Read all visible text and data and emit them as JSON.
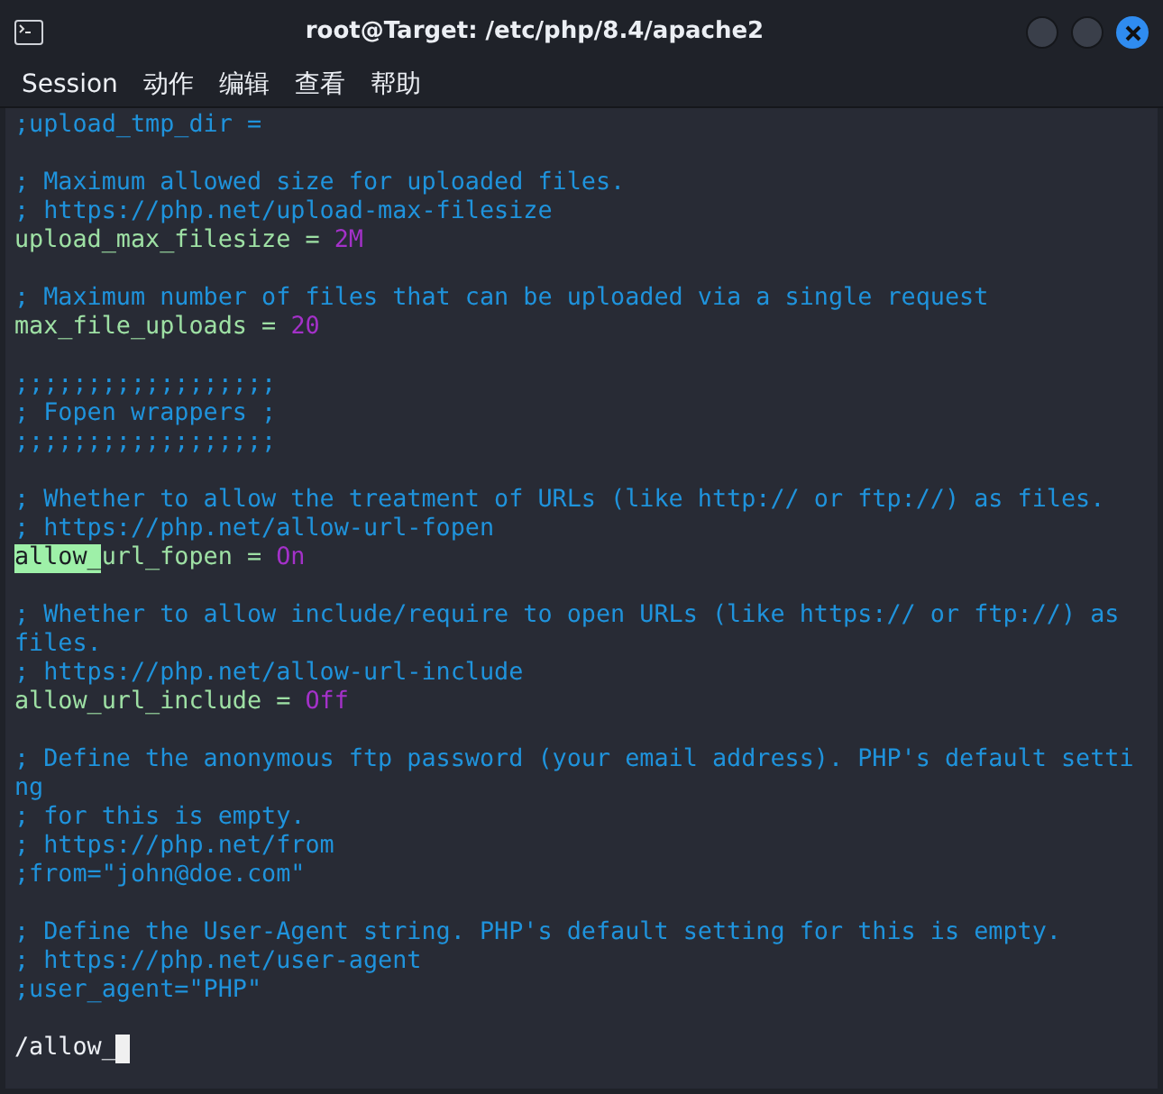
{
  "window": {
    "title": "root@Target: /etc/php/8.4/apache2"
  },
  "menu": [
    "Session",
    "动作",
    "编辑",
    "查看",
    "帮助"
  ],
  "lines": [
    {
      "kind": "text",
      "segments": [
        {
          "kind": "comment",
          "text": ";upload_tmp_dir ="
        }
      ]
    },
    {
      "kind": "blank"
    },
    {
      "kind": "text",
      "segments": [
        {
          "kind": "comment",
          "text": "; Maximum allowed size for uploaded files."
        }
      ]
    },
    {
      "kind": "text",
      "segments": [
        {
          "kind": "comment",
          "text": "; https://php.net/upload-max-filesize"
        }
      ]
    },
    {
      "kind": "text",
      "segments": [
        {
          "kind": "key",
          "text": "upload_max_filesize = "
        },
        {
          "kind": "value",
          "text": "2M"
        }
      ]
    },
    {
      "kind": "blank"
    },
    {
      "kind": "text",
      "segments": [
        {
          "kind": "comment",
          "text": "; Maximum number of files that can be uploaded via a single request"
        }
      ]
    },
    {
      "kind": "text",
      "segments": [
        {
          "kind": "key",
          "text": "max_file_uploads = "
        },
        {
          "kind": "value",
          "text": "20"
        }
      ]
    },
    {
      "kind": "blank"
    },
    {
      "kind": "text",
      "segments": [
        {
          "kind": "comment",
          "text": ";;;;;;;;;;;;;;;;;;"
        }
      ]
    },
    {
      "kind": "text",
      "segments": [
        {
          "kind": "comment",
          "text": "; Fopen wrappers ;"
        }
      ]
    },
    {
      "kind": "text",
      "segments": [
        {
          "kind": "comment",
          "text": ";;;;;;;;;;;;;;;;;;"
        }
      ]
    },
    {
      "kind": "blank"
    },
    {
      "kind": "text",
      "segments": [
        {
          "kind": "comment",
          "text": "; Whether to allow the treatment of URLs (like http:// or ftp://) as files."
        }
      ]
    },
    {
      "kind": "text",
      "segments": [
        {
          "kind": "comment",
          "text": "; https://php.net/allow-url-fopen"
        }
      ]
    },
    {
      "kind": "text",
      "segments": [
        {
          "kind": "match",
          "text": "allow_"
        },
        {
          "kind": "key",
          "text": "url_fopen = "
        },
        {
          "kind": "value",
          "text": "On"
        }
      ]
    },
    {
      "kind": "blank"
    },
    {
      "kind": "text",
      "segments": [
        {
          "kind": "comment",
          "text": "; Whether to allow include/require to open URLs (like https:// or ftp://) as"
        }
      ]
    },
    {
      "kind": "text",
      "segments": [
        {
          "kind": "comment",
          "text": "files."
        }
      ]
    },
    {
      "kind": "text",
      "segments": [
        {
          "kind": "comment",
          "text": "; https://php.net/allow-url-include"
        }
      ]
    },
    {
      "kind": "text",
      "segments": [
        {
          "kind": "key",
          "text": "allow_url_include = "
        },
        {
          "kind": "value",
          "text": "Off"
        }
      ]
    },
    {
      "kind": "blank"
    },
    {
      "kind": "text",
      "segments": [
        {
          "kind": "comment",
          "text": "; Define the anonymous ftp password (your email address). PHP's default setti"
        }
      ]
    },
    {
      "kind": "text",
      "segments": [
        {
          "kind": "comment",
          "text": "ng"
        }
      ]
    },
    {
      "kind": "text",
      "segments": [
        {
          "kind": "comment",
          "text": "; for this is empty."
        }
      ]
    },
    {
      "kind": "text",
      "segments": [
        {
          "kind": "comment",
          "text": "; https://php.net/from"
        }
      ]
    },
    {
      "kind": "text",
      "segments": [
        {
          "kind": "comment",
          "text": ";from=\"john@doe.com\""
        }
      ]
    },
    {
      "kind": "blank"
    },
    {
      "kind": "text",
      "segments": [
        {
          "kind": "comment",
          "text": "; Define the User-Agent string. PHP's default setting for this is empty."
        }
      ]
    },
    {
      "kind": "text",
      "segments": [
        {
          "kind": "comment",
          "text": "; https://php.net/user-agent"
        }
      ]
    },
    {
      "kind": "text",
      "segments": [
        {
          "kind": "comment",
          "text": ";user_agent=\"PHP\""
        }
      ]
    },
    {
      "kind": "blank"
    }
  ],
  "prompt": {
    "text": "/allow_",
    "cursor": true
  }
}
